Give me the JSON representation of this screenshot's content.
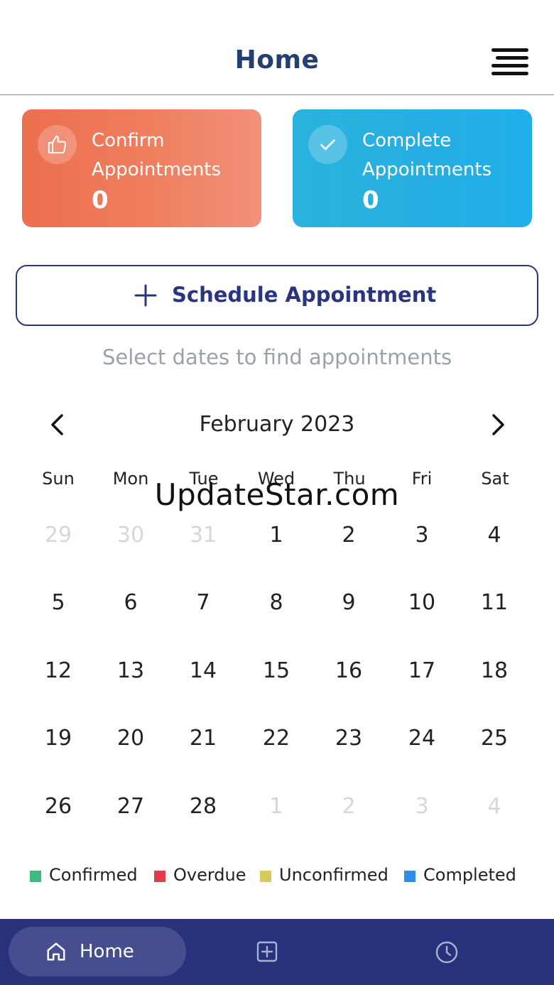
{
  "header": {
    "title": "Home",
    "menu_icon": "hamburger-menu-icon"
  },
  "stats": {
    "confirm": {
      "label": "Confirm Appointments",
      "count": "0",
      "icon": "thumbs-up-icon",
      "color": "#ec6f4e"
    },
    "complete": {
      "label": "Complete Appointments",
      "count": "0",
      "icon": "checkmark-icon",
      "color": "#26aee2"
    }
  },
  "schedule_button": {
    "label": "Schedule Appointment",
    "icon": "plus-icon"
  },
  "hint": "Select dates to find appointments",
  "calendar": {
    "month_label": "February 2023",
    "prev_icon": "chevron-left-icon",
    "next_icon": "chevron-right-icon",
    "weekdays": [
      "Sun",
      "Mon",
      "Tue",
      "Wed",
      "Thu",
      "Fri",
      "Sat"
    ],
    "weeks": [
      [
        {
          "d": "29",
          "m": true
        },
        {
          "d": "30",
          "m": true
        },
        {
          "d": "31",
          "m": true
        },
        {
          "d": "1"
        },
        {
          "d": "2"
        },
        {
          "d": "3"
        },
        {
          "d": "4"
        }
      ],
      [
        {
          "d": "5"
        },
        {
          "d": "6"
        },
        {
          "d": "7"
        },
        {
          "d": "8"
        },
        {
          "d": "9"
        },
        {
          "d": "10"
        },
        {
          "d": "11"
        }
      ],
      [
        {
          "d": "12"
        },
        {
          "d": "13"
        },
        {
          "d": "14"
        },
        {
          "d": "15"
        },
        {
          "d": "16"
        },
        {
          "d": "17"
        },
        {
          "d": "18"
        }
      ],
      [
        {
          "d": "19"
        },
        {
          "d": "20"
        },
        {
          "d": "21"
        },
        {
          "d": "22"
        },
        {
          "d": "23"
        },
        {
          "d": "24"
        },
        {
          "d": "25"
        }
      ],
      [
        {
          "d": "26"
        },
        {
          "d": "27"
        },
        {
          "d": "28"
        },
        {
          "d": "1",
          "m": true
        },
        {
          "d": "2",
          "m": true
        },
        {
          "d": "3",
          "m": true
        },
        {
          "d": "4",
          "m": true
        }
      ]
    ]
  },
  "watermark": "UpdateStar.com",
  "legend": [
    {
      "label": "Confirmed",
      "color": "#3dbb7f"
    },
    {
      "label": "Overdue",
      "color": "#e23b4a"
    },
    {
      "label": "Unconfirmed",
      "color": "#d9c85a"
    },
    {
      "label": "Completed",
      "color": "#2b8fe6"
    }
  ],
  "bottom_nav": {
    "home_label": "Home",
    "home_icon": "home-icon",
    "add_icon": "add-square-icon",
    "history_icon": "clock-icon",
    "background": "#27327a"
  }
}
